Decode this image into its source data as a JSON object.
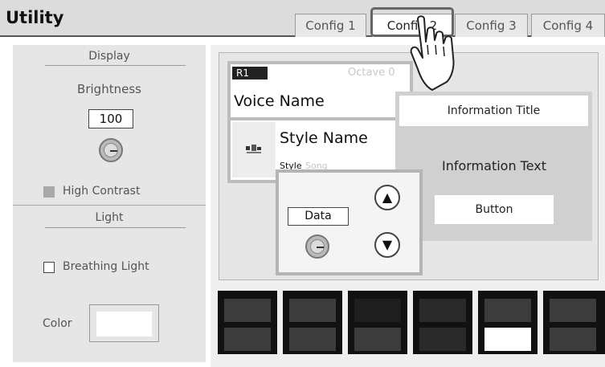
{
  "header": {
    "title": "Utility"
  },
  "tabs": [
    {
      "label": "Config 1"
    },
    {
      "label": "Config 2"
    },
    {
      "label": "Config 3"
    },
    {
      "label": "Config 4"
    }
  ],
  "active_tab": "Config 2",
  "display": {
    "section_label": "Display",
    "brightness_label": "Brightness",
    "brightness_value": "100",
    "high_contrast_label": "High Contrast",
    "high_contrast_checked": false
  },
  "light": {
    "section_label": "Light",
    "breathing_label": "Breathing Light",
    "breathing_checked": false,
    "color_label": "Color"
  },
  "voice": {
    "part": "R1",
    "octave": "Octave 0",
    "name": "Voice Name"
  },
  "style": {
    "name": "Style Name",
    "tab_style": "Style",
    "tab_song": "Song",
    "icon": "style-thumbnail-icon"
  },
  "info": {
    "title": "Information Title",
    "text": "Information Text",
    "button": "Button"
  },
  "data_control": {
    "label": "Data",
    "up": "▲",
    "down": "▼"
  },
  "pads": [
    {
      "top": "#3c3c3c",
      "bottom": "#3c3c3c"
    },
    {
      "top": "#3c3c3c",
      "bottom": "#3c3c3c"
    },
    {
      "top": "#1e1e1e",
      "bottom": "#3c3c3c"
    },
    {
      "top": "#2a2a2a",
      "bottom": "#2a2a2a"
    },
    {
      "top": "#3c3c3c",
      "bottom": "#ffffff"
    },
    {
      "top": "#3c3c3c",
      "bottom": "#3c3c3c"
    }
  ],
  "colors": {
    "header_bg": "#dcdcdc",
    "panel_bg": "#e6e6e6",
    "tab_highlight": "#666666",
    "color_swatch": "#ffffff"
  }
}
